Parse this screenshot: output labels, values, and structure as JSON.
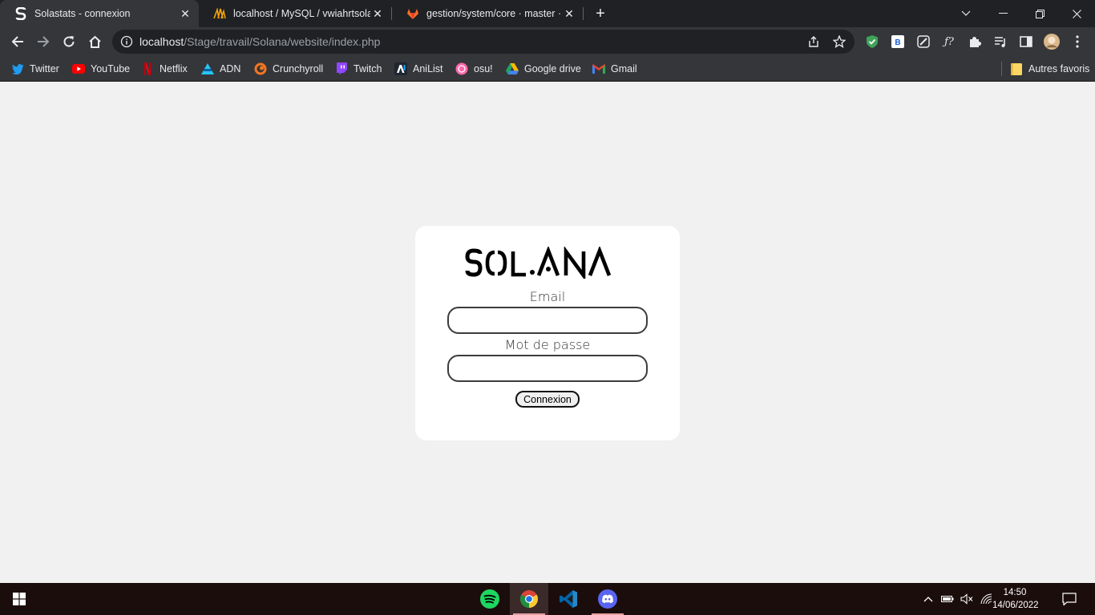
{
  "browser": {
    "tabs": [
      {
        "title": "Solastats - connexion",
        "favicon": "solana-s-icon",
        "active": true
      },
      {
        "title": "localhost / MySQL / vwiahrtsolan",
        "favicon": "phpmyadmin-icon",
        "active": false
      },
      {
        "title": "gestion/system/core · master · ar",
        "favicon": "gitlab-icon",
        "active": false
      }
    ],
    "url_host": "localhost",
    "url_path": "/Stage/travail/Solana/website/index.php",
    "bookmarks": [
      {
        "label": "Twitter",
        "icon": "twitter-icon",
        "color": "#1d9bf0"
      },
      {
        "label": "YouTube",
        "icon": "youtube-icon",
        "color": "#ff0000"
      },
      {
        "label": "Netflix",
        "icon": "netflix-icon",
        "color": "#e50914"
      },
      {
        "label": "ADN",
        "icon": "adn-icon",
        "color": "#27c4f5"
      },
      {
        "label": "Crunchyroll",
        "icon": "crunchyroll-icon",
        "color": "#f47521"
      },
      {
        "label": "Twitch",
        "icon": "twitch-icon",
        "color": "#9146ff"
      },
      {
        "label": "AniList",
        "icon": "anilist-icon",
        "color": "#02a9ff"
      },
      {
        "label": "osu!",
        "icon": "osu-icon",
        "color": "#ff66aa"
      },
      {
        "label": "Google drive",
        "icon": "google-drive-icon",
        "color": "#1fa463"
      },
      {
        "label": "Gmail",
        "icon": "gmail-icon",
        "color": "#ea4335"
      }
    ],
    "other_bookmarks": "Autres favoris"
  },
  "login": {
    "logo_text": "SOLANA",
    "email_label": "Email",
    "email_value": "",
    "password_label": "Mot de passe",
    "password_value": "",
    "submit_label": "Connexion"
  },
  "taskbar": {
    "apps": [
      "spotify-icon",
      "chrome-icon",
      "vscode-icon",
      "discord-icon"
    ],
    "time": "14:50",
    "date": "14/06/2022"
  }
}
